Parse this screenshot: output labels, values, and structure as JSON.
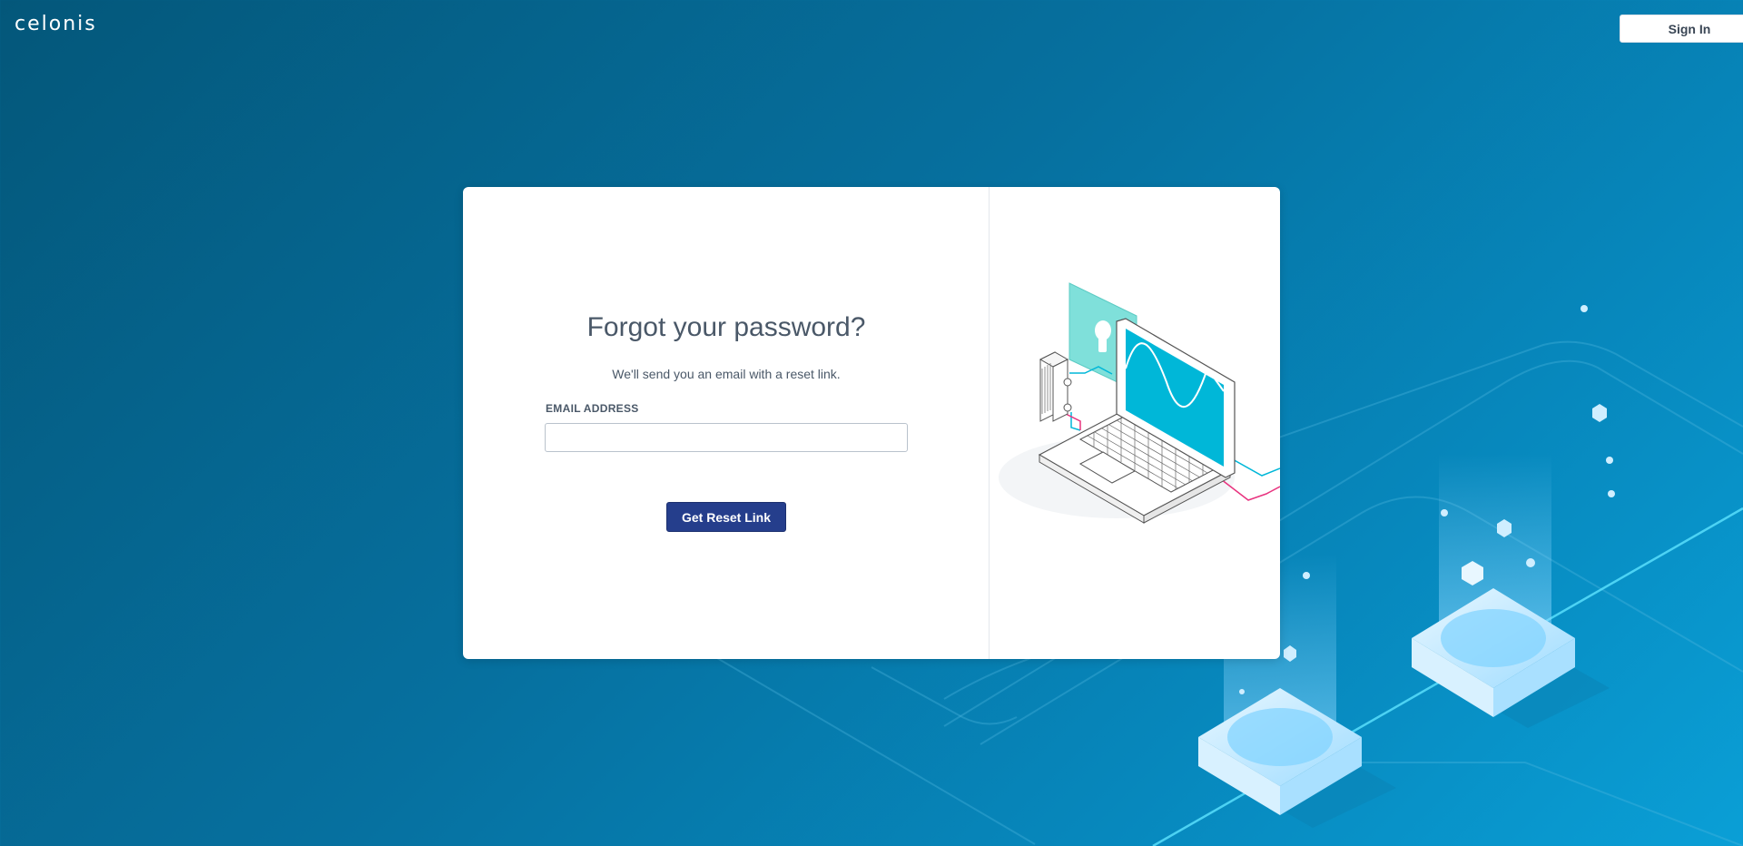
{
  "header": {
    "logo_text": "celonis",
    "signin_label": "Sign In"
  },
  "form": {
    "title": "Forgot your password?",
    "subtitle": "We'll send you an email with a reset link.",
    "email_label": "EMAIL ADDRESS",
    "email_value": "",
    "email_placeholder": "",
    "submit_label": "Get Reset Link"
  },
  "colors": {
    "background_start": "#04577a",
    "background_end": "#0a9fd6",
    "primary_button": "#253e8c",
    "accent_cyan": "#00b7d8",
    "accent_magenta": "#e8337f"
  },
  "icons": {
    "illustration": "laptop-security-illustration",
    "background": "server-network-illustration"
  }
}
